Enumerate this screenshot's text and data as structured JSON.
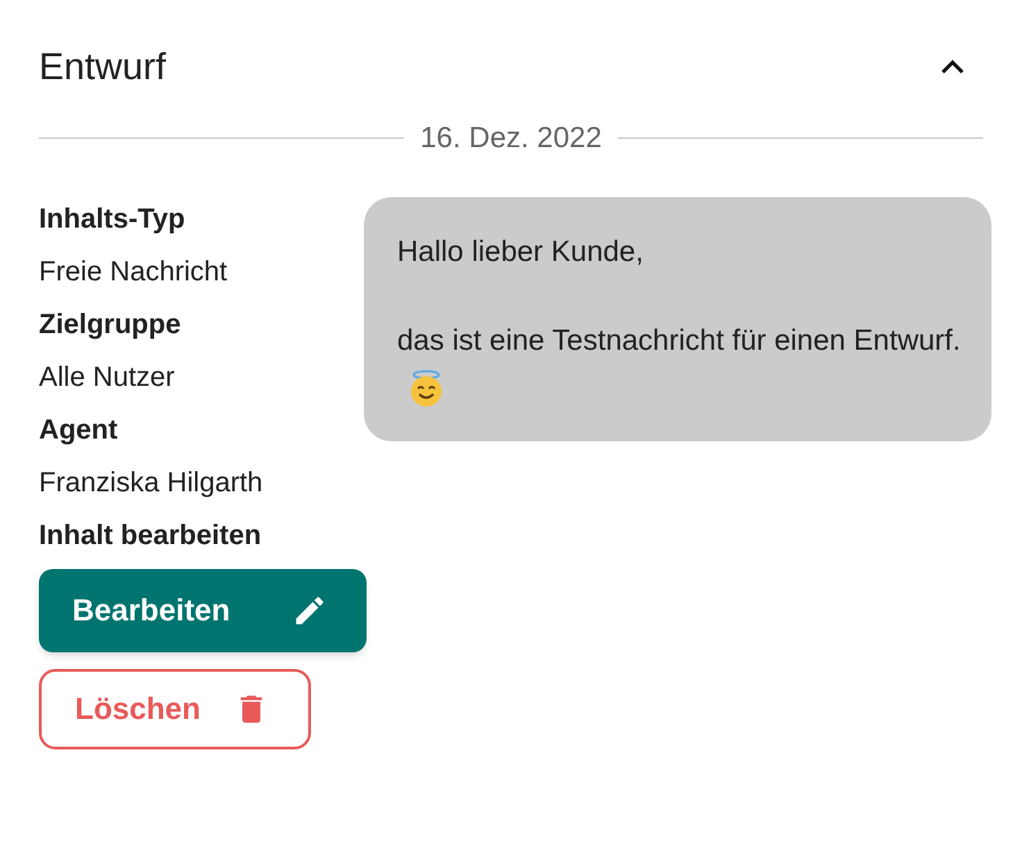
{
  "section": {
    "title": "Entwurf",
    "expanded": true
  },
  "date": "16. Dez. 2022",
  "fields": [
    {
      "label": "Inhalts-Typ",
      "value": "Freie Nachricht"
    },
    {
      "label": "Zielgruppe",
      "value": "Alle Nutzer"
    },
    {
      "label": "Agent",
      "value": "Franziska Hilgarth"
    }
  ],
  "edit_label": "Inhalt bearbeiten",
  "buttons": [
    {
      "kind": "primary",
      "label": "Bearbeiten"
    },
    {
      "kind": "danger",
      "label": "Löschen"
    }
  ],
  "message": {
    "paragraphs": [
      "Hallo lieber Kunde,",
      "das ist eine Testnachricht für einen Entwurf."
    ]
  }
}
